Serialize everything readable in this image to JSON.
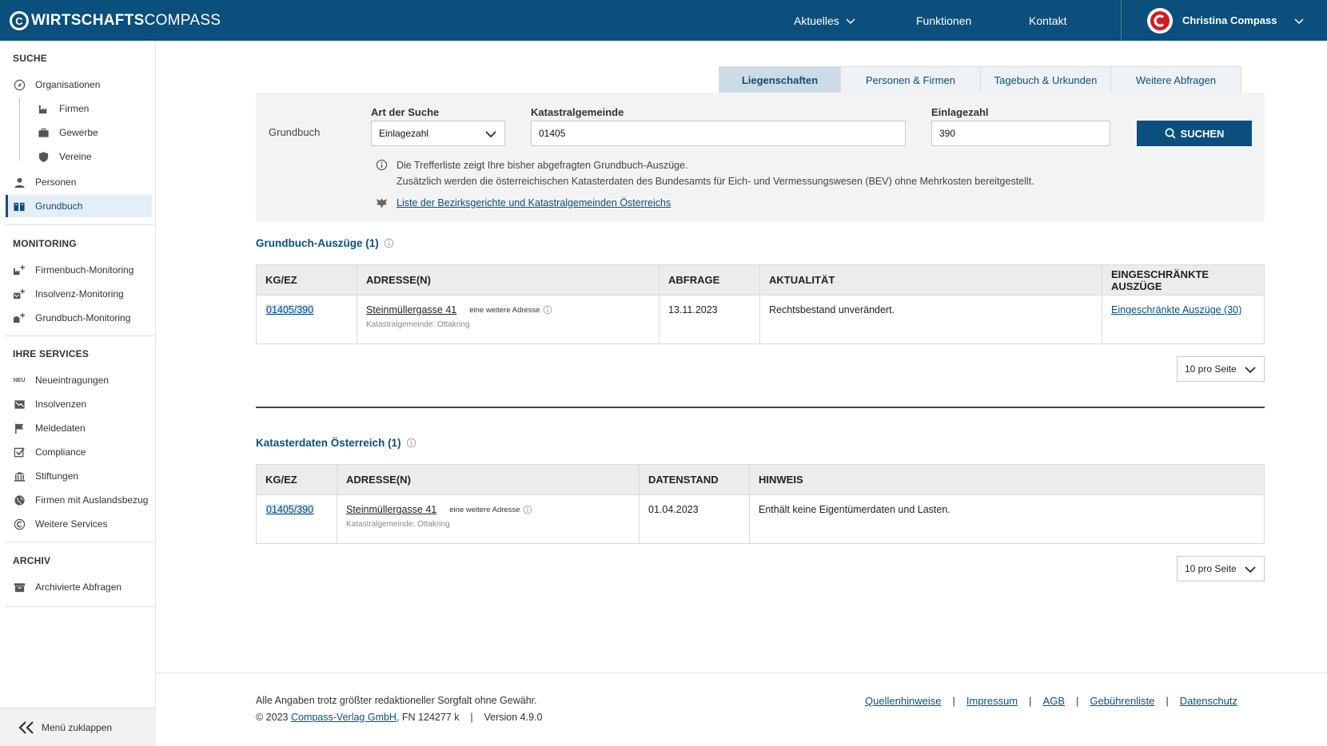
{
  "header": {
    "brand_a": "WIRTSCHAFTS",
    "brand_b": "COMPASS",
    "brand_logo_letter": "C",
    "nav": [
      {
        "label": "Aktuelles"
      },
      {
        "label": "Funktionen"
      },
      {
        "label": "Kontakt"
      }
    ],
    "user_name": "Christina Compass",
    "accent": "#0b4f7c",
    "avatar_color": "#d7191c"
  },
  "sidebar": {
    "suche": "SUCHE",
    "organisationen": "Organisationen",
    "firmen": "Firmen",
    "gewerbe": "Gewerbe",
    "vereine": "Vereine",
    "personen": "Personen",
    "grundbuch": "Grundbuch",
    "monitoring": "MONITORING",
    "firmenbuch_monitoring": "Firmenbuch-Monitoring",
    "insolvenz_monitoring": "Insolvenz-Monitoring",
    "grundbuch_monitoring": "Grundbuch-Monitoring",
    "ihre_services": "IHRE SERVICES",
    "neu_badge": "NEU",
    "neueintragungen": "Neueintragungen",
    "insolvenzen": "Insolvenzen",
    "meldedaten": "Meldedaten",
    "compliance": "Compliance",
    "stiftungen": "Stiftungen",
    "firmen_ausland": "Firmen mit Auslandsbezug",
    "weitere_services": "Weitere Services",
    "archiv": "ARCHIV",
    "archivierte": "Archivierte Abfragen",
    "collapse": "Menü zuklappen"
  },
  "tabs": [
    {
      "label": "Liegenschaften",
      "active": true
    },
    {
      "label": "Personen & Firmen"
    },
    {
      "label": "Tagebuch & Urkunden"
    },
    {
      "label": "Weitere Abfragen"
    }
  ],
  "search": {
    "row_label": "Grundbuch",
    "art_label": "Art der Suche",
    "art_value": "Einlagezahl",
    "kg_label": "Katastralgemeinde",
    "kg_value": "01405",
    "ez_label": "Einlagezahl",
    "ez_value": "390",
    "button": "SUCHEN",
    "info_1": "Die Trefferliste zeigt Ihre bisher abgefragten Grundbuch-Auszüge.",
    "info_2": "Zusätzlich werden die österreichischen Katasterdaten des Bundesamts für Eich- und Vermessungswesen (BEV) ohne Mehrkosten bereitgestellt.",
    "link": "Liste der Bezirksgerichte und Katastralgemeinden Österreichs"
  },
  "section1": {
    "title": "Grundbuch-Auszüge (1)",
    "headers": [
      "KG/EZ",
      "ADRESSE(N)",
      "ABFRAGE",
      "AKTUALITÄT",
      "EINGESCHRÄNKTE AUSZÜGE"
    ],
    "row": {
      "kgez": "01405/390",
      "address": "Steinmüllergasse 41",
      "more": "eine weitere Adresse",
      "kg_note": "Katastralgemeinde: Ottakring",
      "abfrage": "13.11.2023",
      "aktualitaet": "Rechtsbestand unverändert.",
      "eingeschraenkt": "Eingeschränkte Auszüge (30)"
    },
    "pager": "10 pro Seite"
  },
  "section2": {
    "title": "Katasterdaten Österreich (1)",
    "headers": [
      "KG/EZ",
      "ADRESSE(N)",
      "DATENSTAND",
      "HINWEIS"
    ],
    "row": {
      "kgez": "01405/390",
      "address": "Steinmüllergasse 41",
      "more": "eine weitere Adresse",
      "kg_note": "Katastralgemeinde: Ottakring",
      "datenstand": "01.04.2023",
      "hinweis": "Enthält keine Eigentümerdaten und Lasten."
    },
    "pager": "10 pro Seite"
  },
  "footer": {
    "disclaimer": "Alle Angaben trotz größter redaktioneller Sorgfalt ohne Gewähr.",
    "copy_prefix": "© 2023 ",
    "company": "Compass-Verlag GmbH",
    "copy_suffix": ", FN 124277 k    |    Version 4.9.0",
    "links": [
      "Quellenhinweise",
      "Impressum",
      "AGB",
      "Gebührenliste",
      "Datenschutz"
    ]
  }
}
